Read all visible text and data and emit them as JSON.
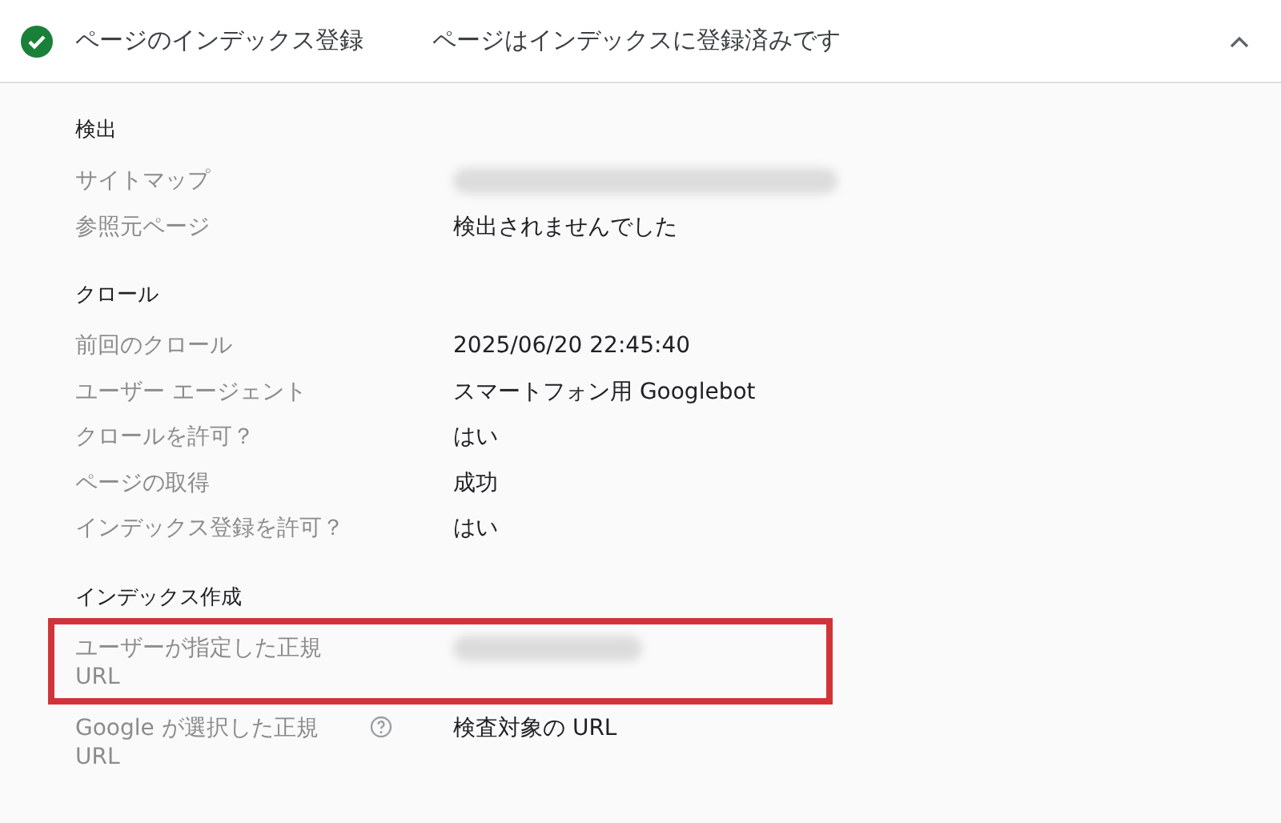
{
  "header": {
    "status_ok": true,
    "title": "ページのインデックス登録",
    "summary": "ページはインデックスに登録済みです",
    "expanded": true
  },
  "sections": [
    {
      "heading": "検出",
      "rows": [
        {
          "label": "サイトマップ",
          "kind": "redacted",
          "highlighted": false
        },
        {
          "label": "参照元ページ",
          "kind": "text",
          "value": "検出されませんでした",
          "highlighted": false
        }
      ]
    },
    {
      "heading": "クロール",
      "rows": [
        {
          "label": "前回のクロール",
          "kind": "text",
          "value": "2025/06/20 22:45:40",
          "highlighted": false
        },
        {
          "label": "ユーザー エージェント",
          "kind": "text",
          "value": "スマートフォン用 Googlebot",
          "highlighted": false
        },
        {
          "label": "クロールを許可？",
          "kind": "text",
          "value": "はい",
          "highlighted": false
        },
        {
          "label": "ページの取得",
          "kind": "text",
          "value": "成功",
          "highlighted": false
        },
        {
          "label": "インデックス登録を許可？",
          "kind": "text",
          "value": "はい",
          "highlighted": false
        }
      ]
    },
    {
      "heading": "インデックス作成",
      "rows": [
        {
          "label": "ユーザーが指定した正規 URL",
          "kind": "redacted",
          "highlighted": true
        },
        {
          "label": "Google が選択した正規 URL",
          "kind": "text",
          "value": "検査対象の URL",
          "help": true,
          "highlighted": false
        }
      ]
    }
  ]
}
